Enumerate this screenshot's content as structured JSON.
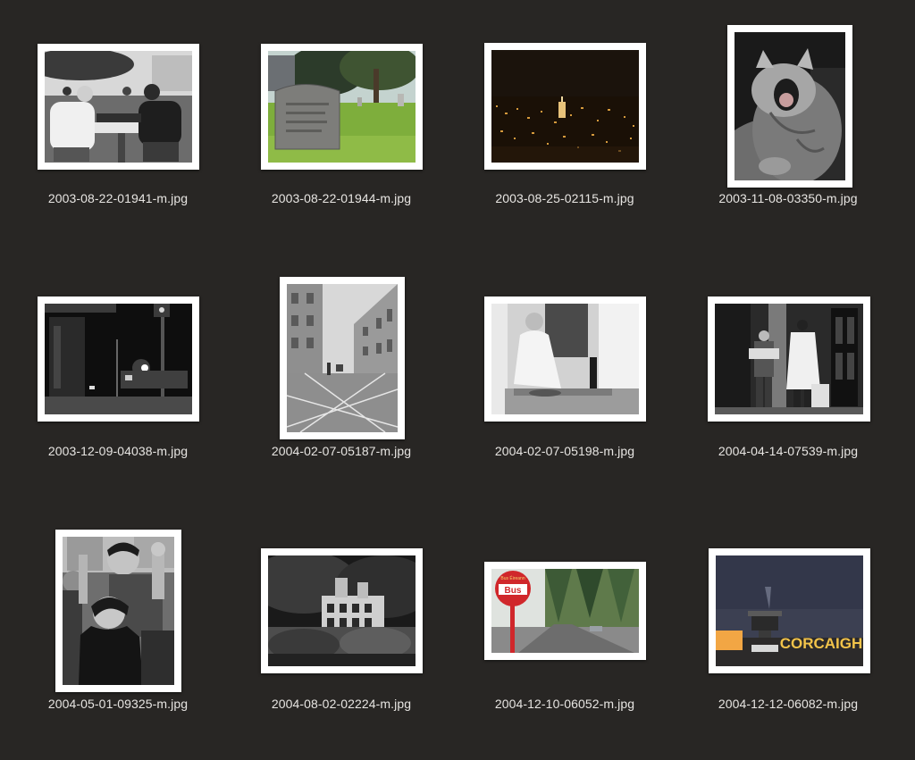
{
  "files": [
    {
      "name": "2003-08-22-01941-m.jpg",
      "subject": "chess-players-photo"
    },
    {
      "name": "2003-08-22-01944-m.jpg",
      "subject": "gravestone-photo"
    },
    {
      "name": "2003-08-25-02115-m.jpg",
      "subject": "city-night-skyline-photo"
    },
    {
      "name": "2003-11-08-03350-m.jpg",
      "subject": "yawning-cat-photo"
    },
    {
      "name": "2003-12-09-04038-m.jpg",
      "subject": "night-street-photo"
    },
    {
      "name": "2004-02-07-05187-m.jpg",
      "subject": "street-buildings-photo"
    },
    {
      "name": "2004-02-07-05198-m.jpg",
      "subject": "butcher-photo"
    },
    {
      "name": "2004-04-14-07539-m.jpg",
      "subject": "doorway-people-photo"
    },
    {
      "name": "2004-05-01-09325-m.jpg",
      "subject": "cheering-crowd-photo"
    },
    {
      "name": "2004-08-02-02224-m.jpg",
      "subject": "ruined-house-photo"
    },
    {
      "name": "2004-12-10-06052-m.jpg",
      "subject": "bus-stop-sign-photo"
    },
    {
      "name": "2004-12-12-06082-m.jpg",
      "subject": "airport-control-tower-photo"
    }
  ],
  "signs": {
    "bus_brand": "Bus Éireann",
    "bus_text": "Bus",
    "tower_text": "CORCAIGH"
  },
  "colors": {
    "background": "#282624",
    "caption": "#e7e5e2",
    "bus_sign_red": "#d0272b",
    "tower_sign_yellow": "#f2c34a"
  }
}
